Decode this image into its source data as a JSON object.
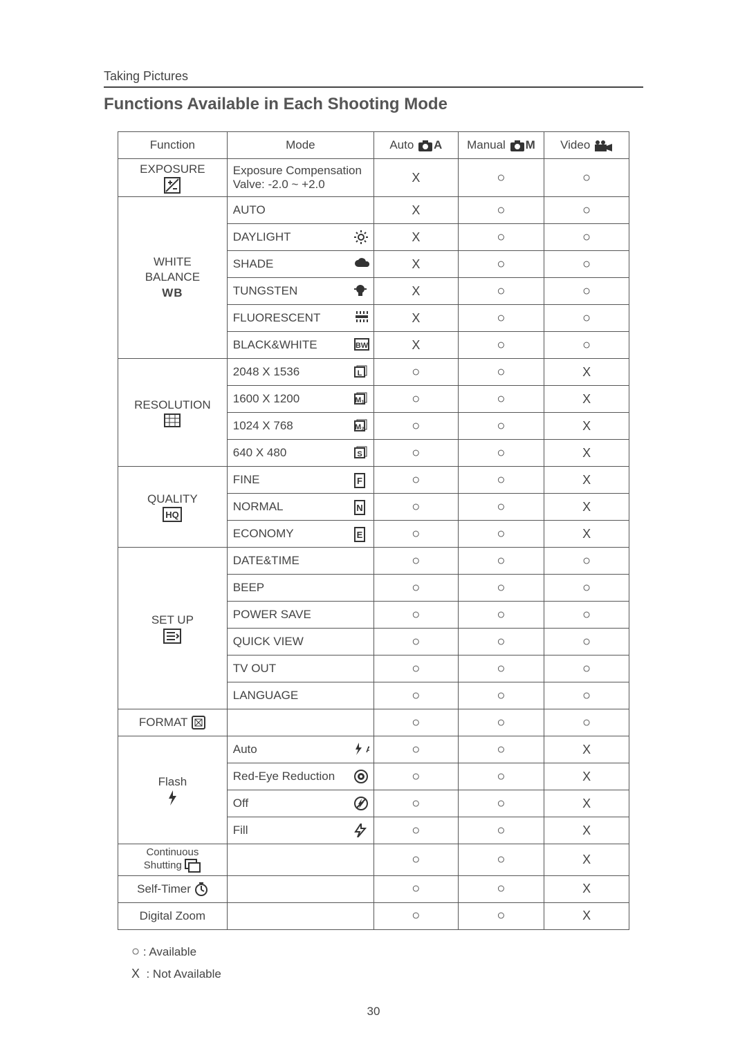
{
  "section": "Taking Pictures",
  "title": "Functions Available in Each Shooting Mode",
  "pageNumber": "30",
  "legend": {
    "available": ": Available",
    "notAvailable": ": Not Available"
  },
  "headers": {
    "function": "Function",
    "mode": "Mode",
    "auto": "Auto",
    "autoSuffix": "A",
    "manual": "Manual",
    "manualSuffix": "M",
    "video": "Video"
  },
  "chart_data": {
    "type": "table",
    "columns": [
      "Auto",
      "Manual",
      "Video"
    ],
    "groups": [
      {
        "function": "EXPOSURE",
        "icon": "exposure",
        "rows": [
          {
            "label": "Exposure Compensation\nValve: -2.0 ~ +2.0",
            "icon": "",
            "values": [
              "X",
              "O",
              "O"
            ]
          }
        ]
      },
      {
        "function": "WHITE\nBALANCE",
        "icon": "wb",
        "rows": [
          {
            "label": "AUTO",
            "icon": "",
            "values": [
              "X",
              "O",
              "O"
            ]
          },
          {
            "label": "DAYLIGHT",
            "icon": "sun",
            "values": [
              "X",
              "O",
              "O"
            ]
          },
          {
            "label": "SHADE",
            "icon": "cloud",
            "values": [
              "X",
              "O",
              "O"
            ]
          },
          {
            "label": "TUNGSTEN",
            "icon": "bulb",
            "values": [
              "X",
              "O",
              "O"
            ]
          },
          {
            "label": "FLUORESCENT",
            "icon": "fluorescent",
            "values": [
              "X",
              "O",
              "O"
            ]
          },
          {
            "label": "BLACK&WHITE",
            "icon": "bw",
            "values": [
              "X",
              "O",
              "O"
            ]
          }
        ]
      },
      {
        "function": "RESOLUTION",
        "icon": "resolution",
        "rows": [
          {
            "label": "2048 X 1536",
            "icon": "size-l",
            "values": [
              "O",
              "O",
              "X"
            ]
          },
          {
            "label": "1600 X 1200",
            "icon": "size-m1",
            "values": [
              "O",
              "O",
              "X"
            ]
          },
          {
            "label": "1024 X 768",
            "icon": "size-m2",
            "values": [
              "O",
              "O",
              "X"
            ]
          },
          {
            "label": "640 X 480",
            "icon": "size-s",
            "values": [
              "O",
              "O",
              "X"
            ]
          }
        ]
      },
      {
        "function": "QUALITY",
        "icon": "quality",
        "rows": [
          {
            "label": "FINE",
            "icon": "q-f",
            "values": [
              "O",
              "O",
              "X"
            ]
          },
          {
            "label": "NORMAL",
            "icon": "q-n",
            "values": [
              "O",
              "O",
              "X"
            ]
          },
          {
            "label": "ECONOMY",
            "icon": "q-e",
            "values": [
              "O",
              "O",
              "X"
            ]
          }
        ]
      },
      {
        "function": "SET UP",
        "icon": "setup",
        "rows": [
          {
            "label": "DATE&TIME",
            "icon": "",
            "values": [
              "O",
              "O",
              "O"
            ]
          },
          {
            "label": "BEEP",
            "icon": "",
            "values": [
              "O",
              "O",
              "O"
            ]
          },
          {
            "label": "POWER SAVE",
            "icon": "",
            "values": [
              "O",
              "O",
              "O"
            ]
          },
          {
            "label": "QUICK VIEW",
            "icon": "",
            "values": [
              "O",
              "O",
              "O"
            ]
          },
          {
            "label": "TV OUT",
            "icon": "",
            "values": [
              "O",
              "O",
              "O"
            ]
          },
          {
            "label": "LANGUAGE",
            "icon": "",
            "values": [
              "O",
              "O",
              "O"
            ]
          }
        ]
      },
      {
        "function": "FORMAT",
        "icon": "format",
        "inline": true,
        "rows": [
          {
            "label": "",
            "icon": "",
            "values": [
              "O",
              "O",
              "O"
            ]
          }
        ]
      },
      {
        "function": "Flash",
        "icon": "flash",
        "rows": [
          {
            "label": "Auto",
            "icon": "flash-a",
            "values": [
              "O",
              "O",
              "X"
            ]
          },
          {
            "label": "Red-Eye Reduction",
            "icon": "redeye",
            "values": [
              "O",
              "O",
              "X"
            ]
          },
          {
            "label": "Off",
            "icon": "flash-off",
            "values": [
              "O",
              "O",
              "X"
            ]
          },
          {
            "label": "Fill",
            "icon": "flash-fill",
            "values": [
              "O",
              "O",
              "X"
            ]
          }
        ]
      },
      {
        "function": "Continuous\nShutting",
        "icon": "continuous",
        "inline": true,
        "small": true,
        "rows": [
          {
            "label": "",
            "icon": "",
            "values": [
              "O",
              "O",
              "X"
            ]
          }
        ]
      },
      {
        "function": "Self-Timer",
        "icon": "timer",
        "inline": true,
        "rows": [
          {
            "label": "",
            "icon": "",
            "values": [
              "O",
              "O",
              "X"
            ]
          }
        ]
      },
      {
        "function": "Digital Zoom",
        "icon": "",
        "inline": true,
        "rows": [
          {
            "label": "",
            "icon": "",
            "values": [
              "O",
              "O",
              "X"
            ]
          }
        ]
      }
    ]
  }
}
